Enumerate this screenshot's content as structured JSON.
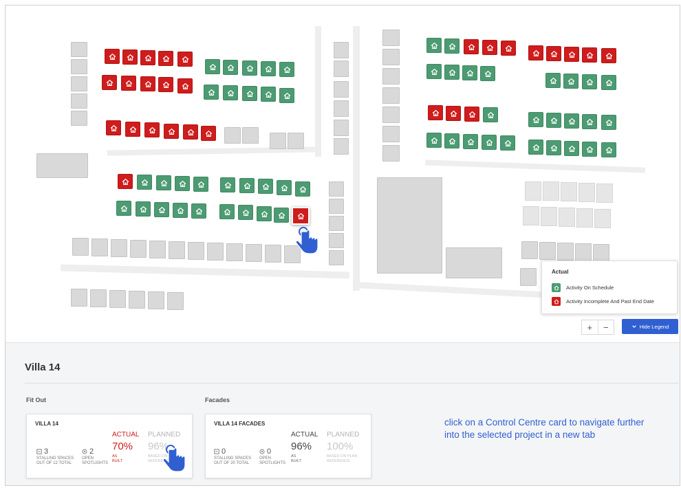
{
  "colors": {
    "on_schedule": "#4c9b72",
    "past_end_date": "#cf1c1c",
    "accent": "#2f5fd1",
    "placeholder_block": "#d9d9d9"
  },
  "map": {
    "units": [
      {
        "status": "red"
      },
      {
        "status": "red"
      },
      {
        "status": "red"
      },
      {
        "status": "red"
      },
      {
        "status": "red"
      },
      {
        "status": "green"
      },
      {
        "status": "green"
      },
      {
        "status": "green"
      },
      {
        "status": "green"
      },
      {
        "status": "green"
      },
      {
        "status": "red"
      },
      {
        "status": "red"
      },
      {
        "status": "red"
      },
      {
        "status": "red"
      },
      {
        "status": "red"
      },
      {
        "status": "green"
      },
      {
        "status": "green"
      },
      {
        "status": "green"
      },
      {
        "status": "green"
      },
      {
        "status": "green"
      },
      {
        "status": "red"
      },
      {
        "status": "red"
      },
      {
        "status": "red"
      },
      {
        "status": "red"
      },
      {
        "status": "red"
      },
      {
        "status": "red"
      },
      {
        "status": "red"
      },
      {
        "status": "green"
      },
      {
        "status": "green"
      },
      {
        "status": "green"
      },
      {
        "status": "green"
      },
      {
        "status": "green"
      },
      {
        "status": "green"
      },
      {
        "status": "green"
      },
      {
        "status": "green"
      },
      {
        "status": "green"
      },
      {
        "status": "green"
      },
      {
        "status": "green"
      },
      {
        "status": "green"
      },
      {
        "status": "green"
      },
      {
        "status": "green"
      },
      {
        "status": "green"
      },
      {
        "status": "green"
      },
      {
        "status": "green"
      },
      {
        "status": "green"
      },
      {
        "status": "red",
        "selected": true
      },
      {
        "status": "green"
      },
      {
        "status": "green"
      },
      {
        "status": "red"
      },
      {
        "status": "red"
      },
      {
        "status": "red"
      },
      {
        "status": "red"
      },
      {
        "status": "red"
      },
      {
        "status": "red"
      },
      {
        "status": "red"
      },
      {
        "status": "red"
      },
      {
        "status": "green"
      },
      {
        "status": "green"
      },
      {
        "status": "green"
      },
      {
        "status": "green"
      },
      {
        "status": "green"
      },
      {
        "status": "green"
      },
      {
        "status": "green"
      },
      {
        "status": "green"
      },
      {
        "status": "red"
      },
      {
        "status": "red"
      },
      {
        "status": "red"
      },
      {
        "status": "green"
      },
      {
        "status": "green"
      },
      {
        "status": "green"
      },
      {
        "status": "green"
      },
      {
        "status": "green"
      },
      {
        "status": "green"
      },
      {
        "status": "green"
      },
      {
        "status": "green"
      },
      {
        "status": "green"
      },
      {
        "status": "green"
      },
      {
        "status": "green"
      },
      {
        "status": "green"
      },
      {
        "status": "green"
      },
      {
        "status": "green"
      },
      {
        "status": "green"
      },
      {
        "status": "green"
      }
    ],
    "legend": {
      "title": "Actual",
      "items": [
        {
          "label": "Activity On Schedule",
          "status": "green"
        },
        {
          "label": "Activity Incomplete And Past End Date",
          "status": "red"
        }
      ]
    },
    "zoom_in": "+",
    "zoom_out": "−",
    "hide_legend": "Hide Legend"
  },
  "panel": {
    "title": "Villa 14",
    "sections": [
      {
        "title": "Fit Out",
        "card": {
          "name": "VILLA 14",
          "stalling_count": "3",
          "stalling_label": "STALLING SPACES OUT OF 12 TOTAL",
          "spotlights_count": "2",
          "spotlights_label": "OPEN SPOTLIGHTS",
          "actual_label": "ACTUAL",
          "actual_pct": "70%",
          "actual_sub": "AS BUILT",
          "planned_label": "PLANNED",
          "planned_pct": "96%",
          "planned_sub": "BASED ON PLAN REFERENCE"
        }
      },
      {
        "title": "Facades",
        "card": {
          "name": "VILLA 14 FACADES",
          "stalling_count": "0",
          "stalling_label": "STALLING SPACES OUT OF 20 TOTAL",
          "spotlights_count": "0",
          "spotlights_label": "OPEN SPOTLIGHTS",
          "actual_label": "ACTUAL",
          "actual_pct": "96%",
          "actual_sub": "AS BUILT",
          "planned_label": "PLANNED",
          "planned_pct": "100%",
          "planned_sub": "BASED ON PLAN REFERENCE"
        }
      }
    ],
    "hint": "click on a Control Centre card to navigate further into the selected project in a new tab"
  }
}
